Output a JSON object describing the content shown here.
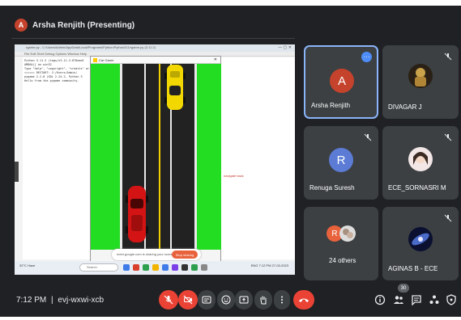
{
  "meeting": {
    "presenter_initial": "A",
    "presenter_label": "Arsha Renjith (Presenting)",
    "time": "7:12 PM",
    "separator": "|",
    "code": "evj-wxwi-xcb",
    "participant_count": "30"
  },
  "shared_screen": {
    "window_title": "rgame.py - C:/Users/Admin/AppData/Local/Programs/Python/Python311/rgame.py (3.11.2)",
    "menu": "File  Edit  Shell  Debug  Options  Window  Help",
    "code_lines": [
      "Python 3.11.2 (tags/v3.11.2:878ead1",
      "AMD64)] on win32",
      "Type \"help\", \"copyright\", \"credits\" or",
      "",
      "====== RESTART: C:/Users/Admin/",
      "pygame 2.2.0 (SDL 2.24.2, Python 3",
      "Hello from the pygame community."
    ],
    "side_text": "navigate back",
    "game_window_title": "Car Game",
    "notice_text": "meet.google.com is sharing your screen",
    "stop_label": "Stop sharing",
    "taskbar_weather": "32°C  Haze",
    "taskbar_search": "Search",
    "taskbar_tray": "ENG  7:12 PM  27-03-2023"
  },
  "tiles": [
    {
      "name": "Arsha Renjith",
      "initial": "A",
      "avatar_color": "#c5432c",
      "muted": false,
      "more_icon": "more-dots-icon"
    },
    {
      "name": "DIVAGAR J",
      "photo": "golden-statue",
      "muted": true
    },
    {
      "name": "Renuga Suresh",
      "initial": "R",
      "avatar_color": "#5b7bd5",
      "muted": true
    },
    {
      "name": "ECE_SORNASRI M",
      "photo": "anime-girl",
      "muted": true
    },
    {
      "name": "24 others",
      "initial": "R",
      "avatar_color": "#e8623c",
      "muted": false
    },
    {
      "name": "AGINAS B - ECE",
      "photo": "galaxy",
      "muted": true
    }
  ],
  "controls": [
    {
      "name": "mic-off-icon",
      "color": "#ea4335"
    },
    {
      "name": "camera-off-icon",
      "color": "#ea4335"
    },
    {
      "name": "captions-icon",
      "color": "#3c4043"
    },
    {
      "name": "emoji-icon",
      "color": "#3c4043"
    },
    {
      "name": "present-icon",
      "color": "#3c4043"
    },
    {
      "name": "raise-hand-icon",
      "color": "#3c4043"
    },
    {
      "name": "more-options-icon",
      "color": "#3c4043"
    },
    {
      "name": "leave-call-icon",
      "color": "#ea4335"
    }
  ],
  "right_icons": [
    "info-icon",
    "people-icon",
    "chat-icon",
    "activities-icon",
    "host-controls-icon"
  ],
  "colors": {
    "background": "#202124",
    "tile": "#3c4043",
    "danger": "#ea4335",
    "accent_blue": "#4e8cf7",
    "grass": "#22dd22",
    "road": "#222222"
  }
}
